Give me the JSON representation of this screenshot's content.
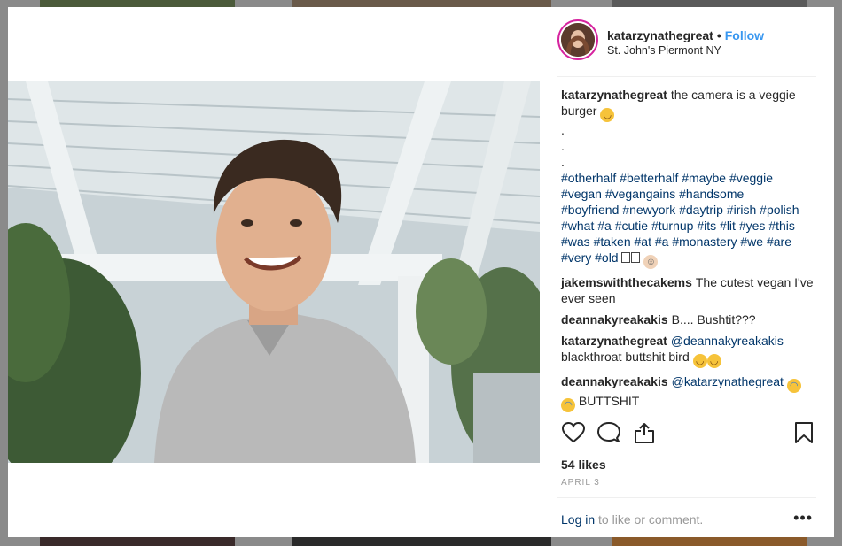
{
  "post": {
    "username": "katarzynathegreat",
    "follow_label": "Follow",
    "location": "St. John's Piermont NY"
  },
  "caption": {
    "username": "katarzynathegreat",
    "text": "the camera is a veggie burger",
    "dots": [
      ".",
      ".",
      "."
    ],
    "hashtags_1": [
      "#otherhalf",
      "#betterhalf",
      "#maybe",
      "#veggie"
    ],
    "hashtags_2": [
      "#vegan",
      "#vegangains",
      "#handsome"
    ],
    "hashtags_3": [
      "#boyfriend",
      "#newyork",
      "#daytrip",
      "#irish",
      "#polish"
    ],
    "hashtags_4": [
      "#what",
      "#a",
      "#cutie",
      "#turnup",
      "#its",
      "#lit",
      "#yes",
      "#this"
    ],
    "hashtags_5": [
      "#was",
      "#taken",
      "#at",
      "#a",
      "#monastery",
      "#we",
      "#are"
    ],
    "hashtags_6": [
      "#very",
      "#old"
    ]
  },
  "comments": [
    {
      "username": "jakemswiththecakems",
      "text": "The cutest vegan I've ever seen"
    },
    {
      "username": "deannakyreakakis",
      "text": "B.... Bushtit???"
    },
    {
      "username": "katarzynathegreat",
      "mention": "@deannakyreakakis",
      "text": "blackthroat buttshit bird"
    },
    {
      "username": "deannakyreakakis",
      "mention": "@katarzynathegreat",
      "text": "BUTTSHIT"
    }
  ],
  "actions": {
    "likes": "54 likes",
    "date": "APRIL 3"
  },
  "login": {
    "link": "Log in",
    "text": "to like or comment.",
    "more": "•••"
  },
  "icons": {
    "like": "heart-icon",
    "comment": "comment-icon",
    "share": "share-icon",
    "save": "bookmark-icon"
  }
}
